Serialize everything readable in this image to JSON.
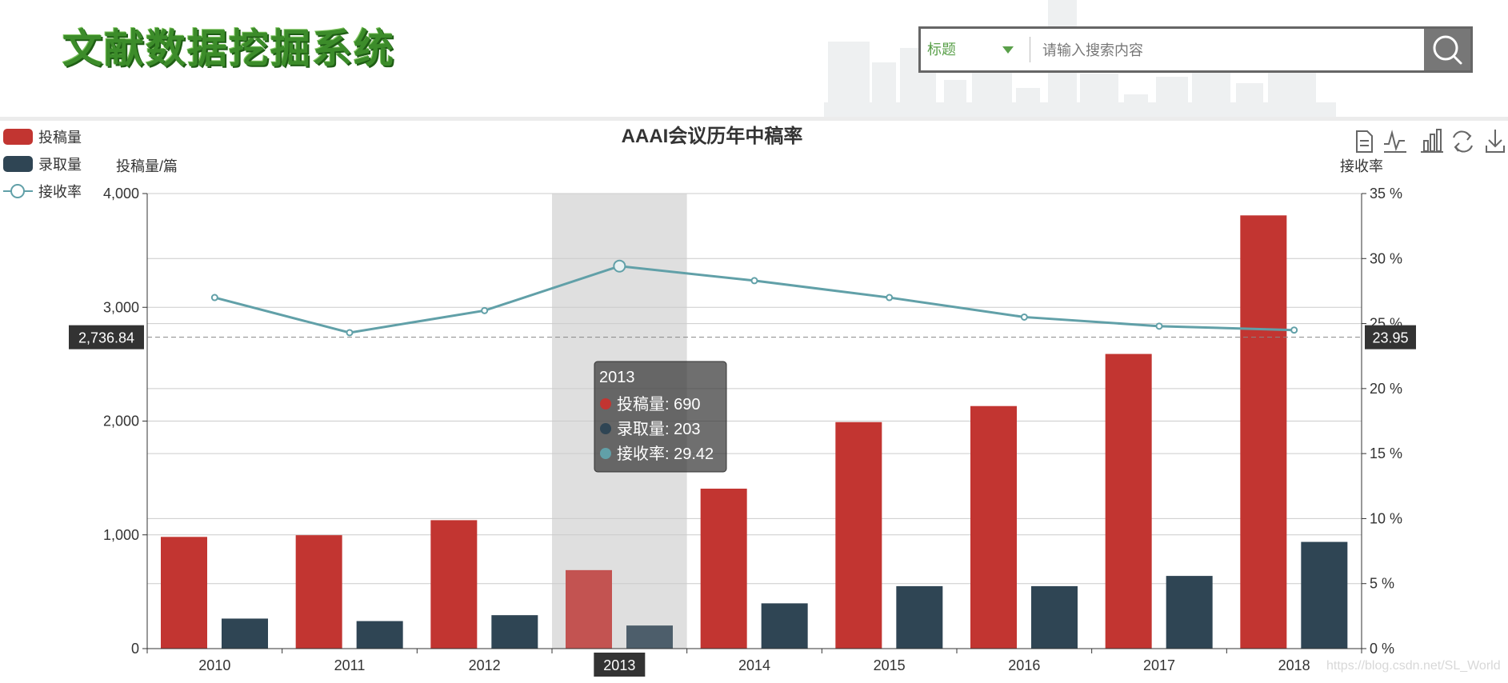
{
  "header": {
    "logo_text": "文献数据挖掘系统",
    "search": {
      "field_label": "标题",
      "placeholder": "请输入搜索内容",
      "search_icon": "search-icon",
      "dropdown_icon": "caret-down-icon"
    }
  },
  "colors": {
    "submissions": "#c23531",
    "accepted": "#2f4554",
    "rate": "#61a0a8",
    "brand_green": "#3c8c2a"
  },
  "toolbox": [
    "data-view-icon",
    "line-chart-icon",
    "bar-chart-icon",
    "restore-icon",
    "download-icon"
  ],
  "watermark": "https://blog.csdn.net/SL_World",
  "chart_data": {
    "type": "bar",
    "title": "AAAI会议历年中稿率",
    "categories": [
      "2010",
      "2011",
      "2012",
      "2013",
      "2014",
      "2015",
      "2016",
      "2017",
      "2018"
    ],
    "series": [
      {
        "name": "投稿量",
        "type": "bar",
        "axis": "left",
        "values": [
          982,
          997,
          1129,
          690,
          1406,
          1991,
          2132,
          2590,
          3808
        ]
      },
      {
        "name": "录取量",
        "type": "bar",
        "axis": "left",
        "values": [
          264,
          242,
          294,
          203,
          398,
          549,
          549,
          639,
          938
        ]
      },
      {
        "name": "接收率",
        "type": "line",
        "axis": "right",
        "values": [
          27.0,
          24.3,
          26.0,
          29.42,
          28.3,
          27.0,
          25.5,
          24.8,
          24.5
        ]
      }
    ],
    "y_left": {
      "label": "投稿量/篇",
      "min": 0,
      "max": 4000,
      "ticks": [
        0,
        1000,
        2000,
        3000,
        4000
      ],
      "tick_labels": [
        "0",
        "1,000",
        "2,000",
        "3,000",
        "4,000"
      ]
    },
    "y_right": {
      "label": "接收率",
      "min": 0,
      "max": 35,
      "ticks": [
        0,
        5,
        10,
        15,
        20,
        25,
        30,
        35
      ],
      "tick_labels": [
        "0 %",
        "5 %",
        "10 %",
        "15 %",
        "20 %",
        "25 %",
        "30 %",
        "35 %"
      ]
    },
    "grid": true,
    "legend_position": "top-left",
    "pointer": {
      "category": "2013",
      "y_left_label": "2,736.84",
      "y_right_label": "23.95",
      "y_right_value": 23.95
    },
    "tooltip": {
      "title": "2013",
      "rows": [
        "投稿量: 690",
        "录取量: 203",
        "接收率: 29.42"
      ]
    }
  }
}
